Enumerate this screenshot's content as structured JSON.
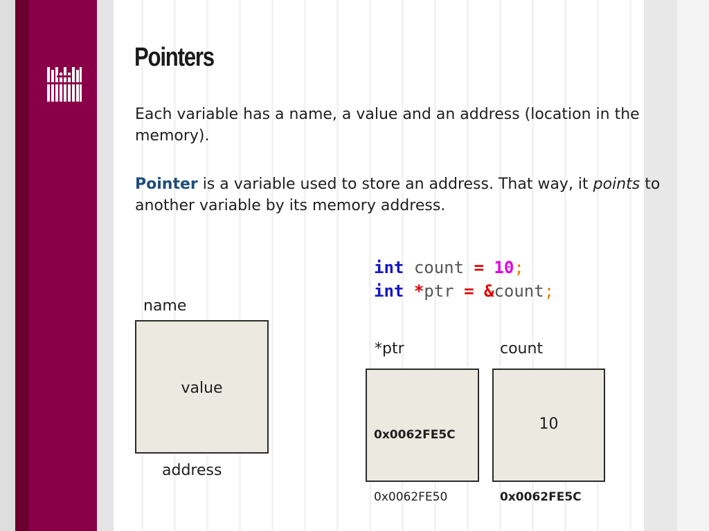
{
  "slide": {
    "title": "Pointers",
    "para1": "Each variable has a name, a value and an address (location in the memory).",
    "para2": {
      "term": "Pointer",
      "part1": " is a variable used to store an address. That way, it ",
      "emph": "points",
      "part2": " to another variable by its memory address."
    }
  },
  "code": {
    "line1": {
      "type": "int",
      "name": "count",
      "eq": "=",
      "value": "10",
      "semi": ";"
    },
    "line2": {
      "type": "int",
      "star": "*",
      "name": "ptr",
      "eq": "=",
      "amp": "&",
      "ref": "count",
      "semi": ";"
    }
  },
  "diagram": {
    "generic": {
      "name": "name",
      "value": "value",
      "address": "address"
    },
    "ptr_var": {
      "name": "*ptr",
      "value": "0x0062FE5C",
      "address": "0x0062FE50"
    },
    "count_var": {
      "name": "count",
      "value": "10",
      "address": "0x0062FE5C"
    }
  },
  "colors": {
    "band": "#8a0048",
    "keyword_type": "#1414c8",
    "operator": "#e00000",
    "number": "#e000e0",
    "pointer_term": "#1f4e79",
    "box_fill": "#ebe9e0"
  },
  "icons": {
    "logo": "university-logo-icon"
  }
}
